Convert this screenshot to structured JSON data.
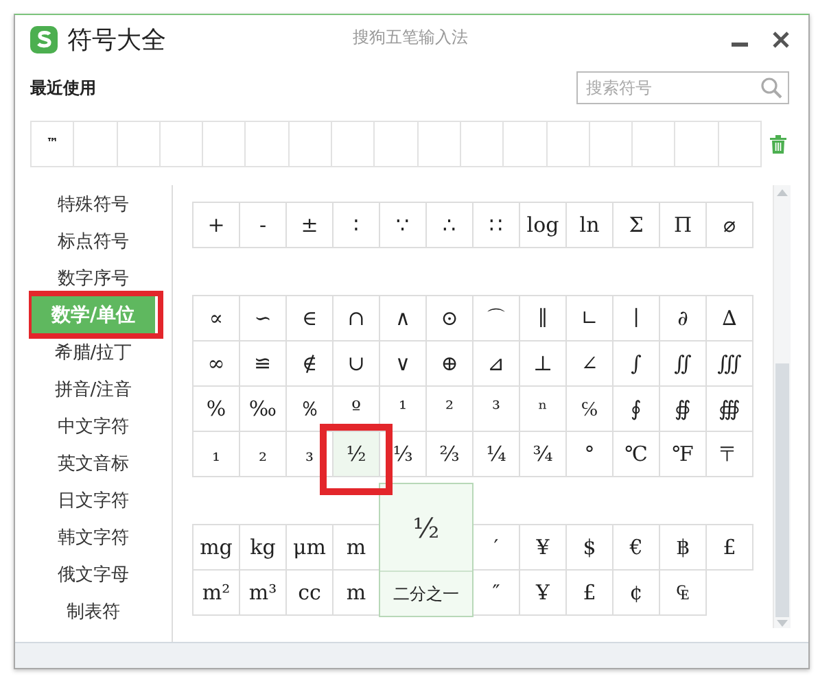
{
  "window": {
    "title": "符号大全",
    "app_name": "搜狗五笔输入法"
  },
  "recent": {
    "label": "最近使用",
    "symbols": [
      "™"
    ]
  },
  "search": {
    "placeholder": "搜索符号"
  },
  "sidebar": {
    "items": [
      {
        "label": "特殊符号",
        "selected": false,
        "highlighted": false
      },
      {
        "label": "标点符号",
        "selected": false,
        "highlighted": false
      },
      {
        "label": "数字序号",
        "selected": false,
        "highlighted": false
      },
      {
        "label": "数学/单位",
        "selected": true,
        "highlighted": true
      },
      {
        "label": "希腊/拉丁",
        "selected": false,
        "highlighted": false
      },
      {
        "label": "拼音/注音",
        "selected": false,
        "highlighted": false
      },
      {
        "label": "中文字符",
        "selected": false,
        "highlighted": false
      },
      {
        "label": "英文音标",
        "selected": false,
        "highlighted": false
      },
      {
        "label": "日文字符",
        "selected": false,
        "highlighted": false
      },
      {
        "label": "韩文字符",
        "selected": false,
        "highlighted": false
      },
      {
        "label": "俄文字母",
        "selected": false,
        "highlighted": false
      },
      {
        "label": "制表符",
        "selected": false,
        "highlighted": false
      }
    ]
  },
  "groups": [
    {
      "rows": [
        [
          {
            "symbol": "+",
            "selected": false
          },
          {
            "symbol": "-",
            "selected": false
          },
          {
            "symbol": "±",
            "selected": false
          },
          {
            "symbol": "∶",
            "selected": false
          },
          {
            "symbol": "∵",
            "selected": false
          },
          {
            "symbol": "∴",
            "selected": false
          },
          {
            "symbol": "∷",
            "selected": false
          },
          {
            "symbol": "log",
            "selected": false
          },
          {
            "symbol": "ln",
            "selected": false
          },
          {
            "symbol": "Σ",
            "selected": false
          },
          {
            "symbol": "Π",
            "selected": false
          },
          {
            "symbol": "⌀",
            "selected": false
          }
        ]
      ]
    },
    {
      "rows": [
        [
          {
            "symbol": "∝",
            "selected": false
          },
          {
            "symbol": "∽",
            "selected": false
          },
          {
            "symbol": "∈",
            "selected": false
          },
          {
            "symbol": "∩",
            "selected": false
          },
          {
            "symbol": "∧",
            "selected": false
          },
          {
            "symbol": "⊙",
            "selected": false
          },
          {
            "symbol": "⌒",
            "selected": false
          },
          {
            "symbol": "∥",
            "selected": false
          },
          {
            "symbol": "∟",
            "selected": false
          },
          {
            "symbol": "∣",
            "selected": false
          },
          {
            "symbol": "∂",
            "selected": false
          },
          {
            "symbol": "∆",
            "selected": false
          }
        ],
        [
          {
            "symbol": "∞",
            "selected": false
          },
          {
            "symbol": "≌",
            "selected": false
          },
          {
            "symbol": "∉",
            "selected": false
          },
          {
            "symbol": "∪",
            "selected": false
          },
          {
            "symbol": "∨",
            "selected": false
          },
          {
            "symbol": "⊕",
            "selected": false
          },
          {
            "symbol": "⊿",
            "selected": false
          },
          {
            "symbol": "⊥",
            "selected": false
          },
          {
            "symbol": "∠",
            "selected": false
          },
          {
            "symbol": "∫",
            "selected": false
          },
          {
            "symbol": "∬",
            "selected": false
          },
          {
            "symbol": "∭",
            "selected": false
          }
        ],
        [
          {
            "symbol": "%",
            "selected": false
          },
          {
            "symbol": "‰",
            "selected": false
          },
          {
            "symbol": "％",
            "selected": false
          },
          {
            "symbol": "º",
            "selected": false
          },
          {
            "symbol": "¹",
            "selected": false
          },
          {
            "symbol": "²",
            "selected": false
          },
          {
            "symbol": "³",
            "selected": false
          },
          {
            "symbol": "ⁿ",
            "selected": false
          },
          {
            "symbol": "℅",
            "selected": false
          },
          {
            "symbol": "∮",
            "selected": false
          },
          {
            "symbol": "∯",
            "selected": false
          },
          {
            "symbol": "∰",
            "selected": false
          }
        ],
        [
          {
            "symbol": "₁",
            "selected": false
          },
          {
            "symbol": "₂",
            "selected": false
          },
          {
            "symbol": "₃",
            "selected": false
          },
          {
            "symbol": "½",
            "selected": true,
            "highlighted": true
          },
          {
            "symbol": "⅓",
            "selected": false
          },
          {
            "symbol": "⅔",
            "selected": false
          },
          {
            "symbol": "¼",
            "selected": false
          },
          {
            "symbol": "¾",
            "selected": false
          },
          {
            "symbol": "°",
            "selected": false
          },
          {
            "symbol": "℃",
            "selected": false
          },
          {
            "symbol": "℉",
            "selected": false
          },
          {
            "symbol": "〒",
            "selected": false
          }
        ]
      ]
    },
    {
      "rows": [
        [
          {
            "symbol": "mg",
            "selected": false
          },
          {
            "symbol": "kg",
            "selected": false
          },
          {
            "symbol": "μm",
            "selected": false
          },
          {
            "symbol": "m",
            "selected": false
          },
          {
            "kind": "covered"
          },
          {
            "kind": "covered"
          },
          {
            "symbol": "′",
            "selected": false
          },
          {
            "symbol": "¥",
            "selected": false
          },
          {
            "symbol": "$",
            "selected": false
          },
          {
            "symbol": "€",
            "selected": false
          },
          {
            "symbol": "฿",
            "selected": false
          },
          {
            "symbol": "£",
            "selected": false
          }
        ],
        [
          {
            "symbol": "m²",
            "selected": false
          },
          {
            "symbol": "m³",
            "selected": false
          },
          {
            "symbol": "cc",
            "selected": false
          },
          {
            "symbol": "m",
            "selected": false
          },
          {
            "kind": "covered"
          },
          {
            "kind": "covered"
          },
          {
            "symbol": "″",
            "selected": false
          },
          {
            "symbol": "Ұ",
            "selected": false
          },
          {
            "symbol": "£",
            "selected": false
          },
          {
            "symbol": "¢",
            "selected": false
          },
          {
            "symbol": "₠",
            "selected": false
          }
        ]
      ]
    }
  ],
  "popup": {
    "symbol": "½",
    "name": "二分之一"
  }
}
